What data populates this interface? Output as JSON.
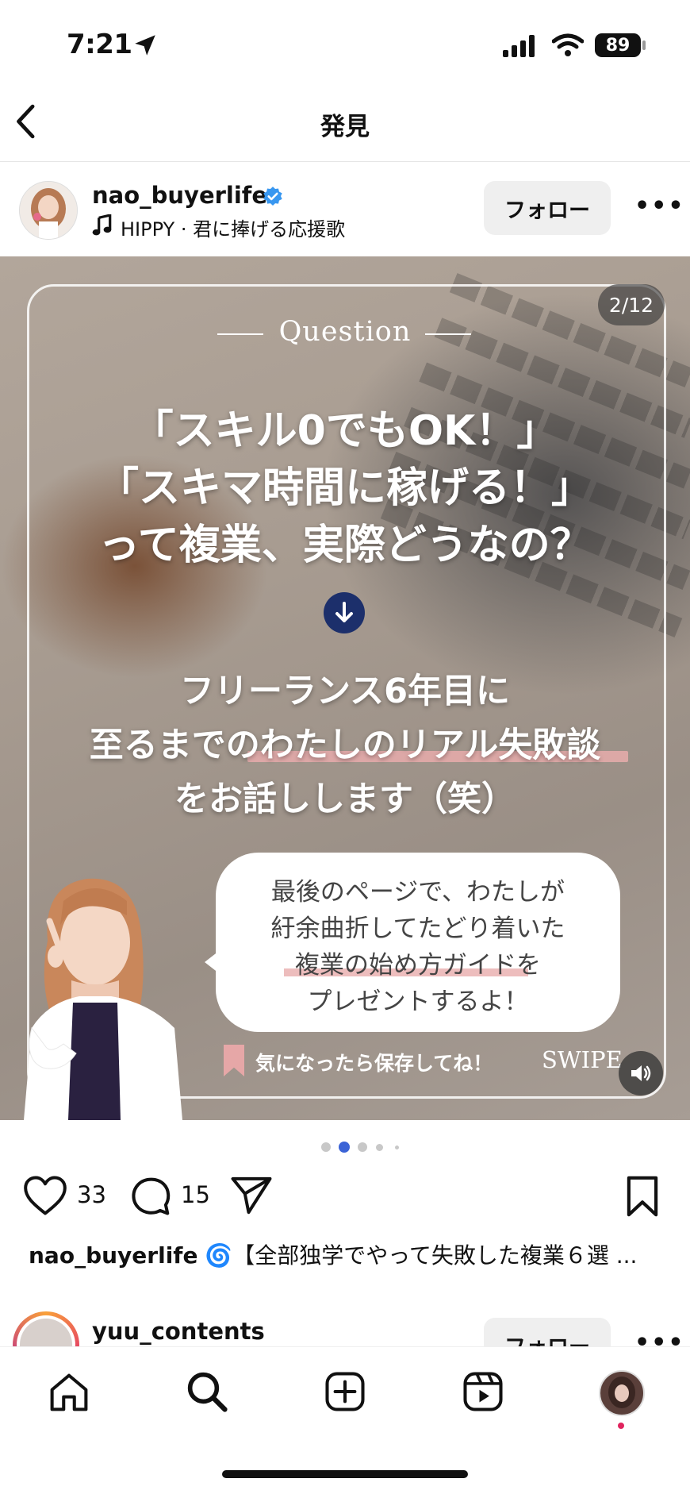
{
  "status_bar": {
    "time": "7:21",
    "battery": "89"
  },
  "header": {
    "title": "発見"
  },
  "post": {
    "username": "nao_buyerlife",
    "verified": true,
    "audio": "HIPPY · 君に捧げる応援歌",
    "follow_label": "フォロー",
    "page_indicator": "2/12",
    "question_label": "Question",
    "headline": [
      "「スキル0でもOK！」",
      "「スキマ時間に稼げる！」",
      "って複業、実際どうなの？"
    ],
    "subline": [
      "フリーランス6年目に",
      "至るまでのわたしのリアル失敗談",
      "をお話しします（笑）"
    ],
    "bubble": [
      "最後のページで、わたしが",
      "紆余曲折してたどり着いた",
      "複業の始め方ガイドを",
      "プレゼントするよ！"
    ],
    "save_text": "気になったら保存してね！",
    "swipe_text": "SWIPE",
    "carousel": {
      "total_dots": 5,
      "active_index": 1
    },
    "likes": "33",
    "comments": "15",
    "caption_user": "nao_buyerlife",
    "caption_text": " 🌀【全部独学でやって失敗した複業６選 ..."
  },
  "next_post": {
    "username": "yuu_contents",
    "follow_label": "フォロー"
  },
  "tabbar": {
    "items": [
      "home",
      "search",
      "create",
      "reels",
      "profile"
    ],
    "notification_dot_color": "#e0245e"
  },
  "colors": {
    "verified": "#3897f0",
    "accent_blue": "#1c2f6b",
    "highlight_pink": "#e8acac"
  }
}
